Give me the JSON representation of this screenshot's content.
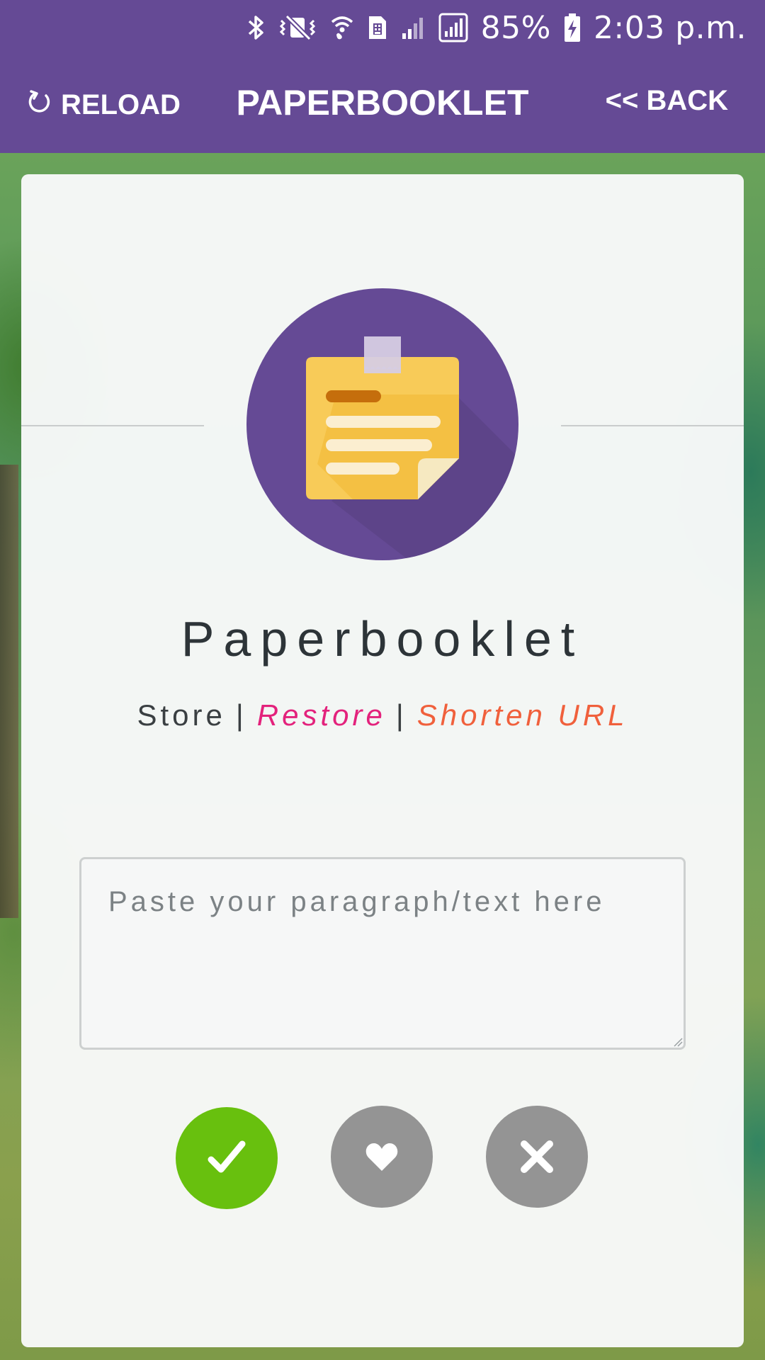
{
  "status_bar": {
    "battery_percent": "85%",
    "time": "2:03 p.m.",
    "icons": [
      "bluetooth-icon",
      "vibrate-mute-icon",
      "wifi-calling-icon",
      "sim-card-icon",
      "signal-icon",
      "signal-boxed-icon",
      "battery-charging-icon"
    ]
  },
  "app_bar": {
    "reload_label": "RELOAD",
    "title": "PAPERBOOKLET",
    "back_label": "<< BACK",
    "reload_icon": "reload-icon"
  },
  "card": {
    "logo_icon": "sticky-note-icon",
    "brand_name": "Paperbooklet",
    "modes": {
      "store": "Store",
      "separator": "|",
      "restore": "Restore",
      "shorten": "Shorten URL"
    },
    "input": {
      "placeholder": "Paste your paragraph/text here",
      "value": ""
    },
    "actions": [
      {
        "name": "submit",
        "icon": "checkmark-icon"
      },
      {
        "name": "favorite",
        "icon": "heart-icon"
      },
      {
        "name": "clear",
        "icon": "close-icon"
      }
    ]
  },
  "colors": {
    "primary": "#654a95",
    "restore_link": "#e3227c",
    "shorten_link": "#f0603c",
    "submit_green": "#68c00e",
    "neutral_gray": "#949494",
    "note_yellow": "#f7c543"
  }
}
